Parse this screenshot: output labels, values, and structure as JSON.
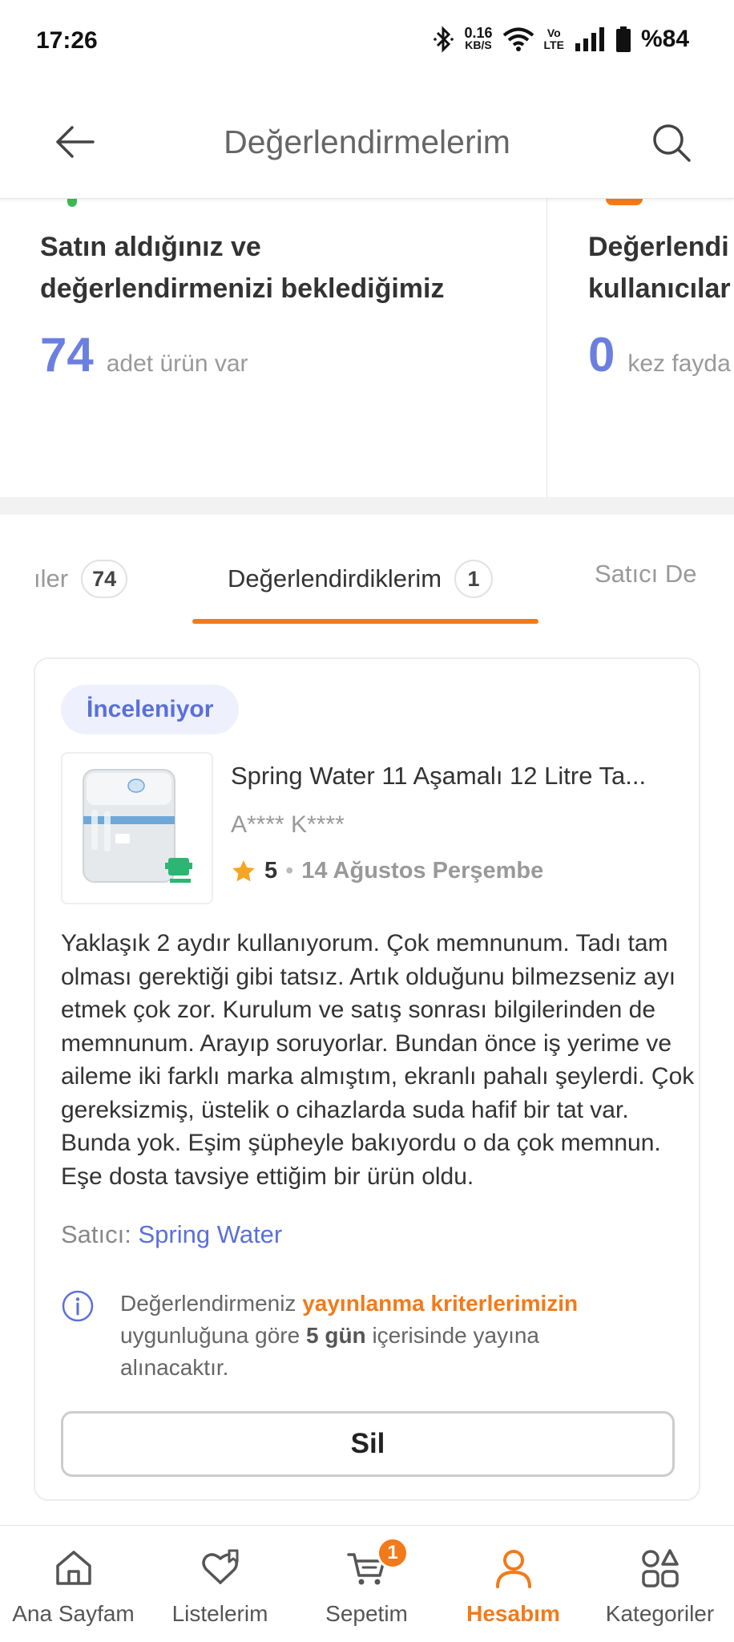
{
  "status_bar": {
    "time": "17:26",
    "net_speed_value": "0.16",
    "net_speed_unit": "KB/S",
    "volte_line1": "Vo",
    "volte_line2": "LTE",
    "battery": "%84",
    "icons": [
      "bluetooth-icon",
      "wifi-icon",
      "signal-icon",
      "battery-icon"
    ]
  },
  "app_bar": {
    "title": "Değerlendirmelerim",
    "icons": [
      "back-arrow-icon",
      "search-icon"
    ]
  },
  "summary": {
    "left": {
      "heading_line1": "Satın aldığınız ve",
      "heading_line2": "değerlendirmenizi beklediğimiz",
      "count": "74",
      "count_label": "adet ürün var"
    },
    "right": {
      "heading_line1": "Değerlendi",
      "heading_line2": "kullanıcılar",
      "count": "0",
      "count_label": "kez fayda"
    }
  },
  "tabs": {
    "left": {
      "label": "ıler",
      "badge": "74"
    },
    "active": {
      "label": "Değerlendirdiklerim",
      "badge": "1"
    },
    "right": {
      "label": "Satıcı De"
    }
  },
  "review": {
    "status": "İnceleniyor",
    "product_title": "Spring Water 11 Aşamalı 12 Litre Ta...",
    "reviewer": "A**** K****",
    "rating": "5",
    "separator": "•",
    "date": "14 Ağustos Perşembe",
    "text_lines": [
      "Yaklaşık 2 aydır kullanıyorum. Çok memnunum. Tadı tam",
      "olması gerektiği gibi tatsız. Artık olduğunu bilmezseniz ayı",
      "etmek çok zor. Kurulum ve satış sonrası bilgilerinden de",
      "memnunum. Arayıp soruyorlar. Bundan önce iş yerime ve",
      "aileme iki farklı marka almıştım, ekranlı pahalı şeylerdi. Çok",
      "gereksizmiş, üstelik o cihazlarda suda hafif bir tat var.",
      "Bunda yok. Eşim şüpheyle bakıyordu o da çok memnun.",
      "Eşe dosta tavsiye ettiğim bir ürün oldu."
    ],
    "seller_label": "Satıcı:",
    "seller_name": "Spring Water",
    "info_prefix": "Değerlendirmeniz",
    "info_link": "yayınlanma kriterlerimizin",
    "info_mid": "uygunluğuna göre",
    "info_days": "5 gün",
    "info_suffix": "içerisinde yayına",
    "info_end": "alınacaktır.",
    "delete_label": "Sil"
  },
  "bottom_nav": {
    "items": [
      {
        "label": "Ana Sayfam",
        "icon": "home-icon"
      },
      {
        "label": "Listelerim",
        "icon": "heart-list-icon"
      },
      {
        "label": "Sepetim",
        "icon": "cart-icon",
        "badge": "1"
      },
      {
        "label": "Hesabım",
        "icon": "user-icon",
        "active": true
      },
      {
        "label": "Kategoriler",
        "icon": "categories-icon"
      }
    ]
  },
  "colors": {
    "accent": "#f27a1a",
    "link_blue": "#5a70d8",
    "count_blue": "#6b7fe0"
  }
}
